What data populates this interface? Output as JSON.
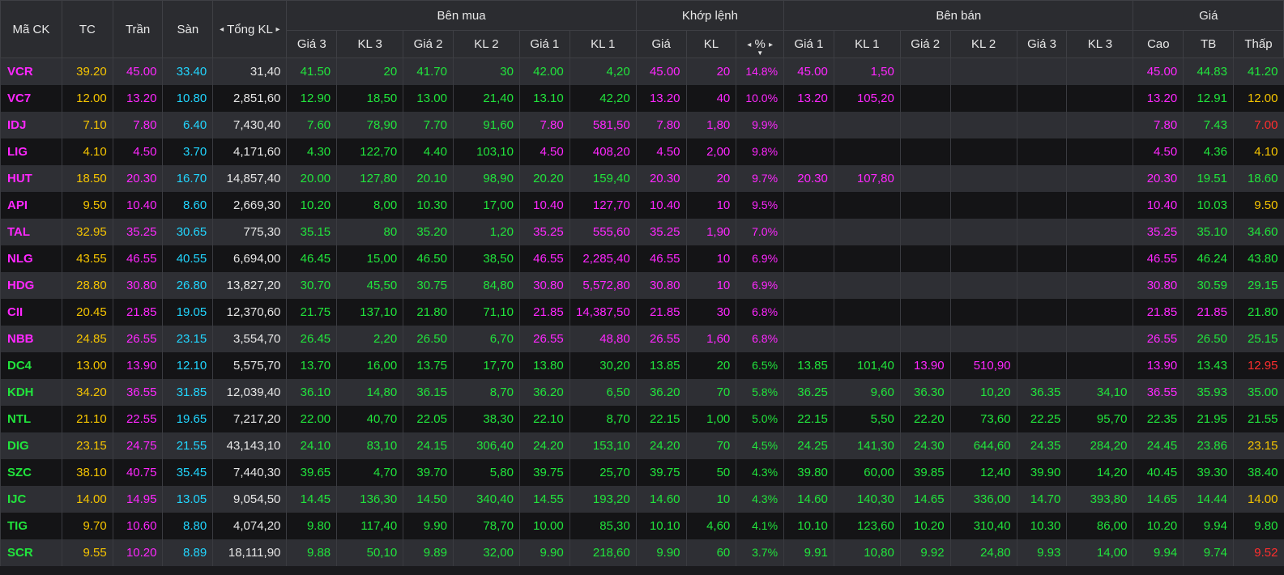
{
  "headers": {
    "symbol": "Mã CK",
    "ref": "TC",
    "ceil": "Trần",
    "floor": "Sàn",
    "total": "Tổng KL",
    "buy_group": "Bên mua",
    "match_group": "Khớp lệnh",
    "sell_group": "Bên bán",
    "price_group": "Giá",
    "buy_cols": [
      "Giá 3",
      "KL 3",
      "Giá 2",
      "KL 2",
      "Giá 1",
      "KL 1"
    ],
    "match_cols": [
      "Giá",
      "KL",
      "%"
    ],
    "sell_cols": [
      "Giá 1",
      "KL 1",
      "Giá 2",
      "KL 2",
      "Giá 3",
      "KL 3"
    ],
    "price_cols": [
      "Cao",
      "TB",
      "Thấp"
    ]
  },
  "icons": {
    "left": "◂",
    "right": "▸",
    "sort_down": "▼"
  },
  "colors": {
    "ref": "#f5c400",
    "ceil": "#ff27ff",
    "floor": "#21d6ff",
    "up": "#21e43c",
    "down": "#ff2e2e"
  },
  "rows": [
    {
      "sym": "VCR",
      "tc": "39.20",
      "tran": "45.00",
      "san": "33.40",
      "tong": "31,40",
      "b3": "41.50",
      "bv3": "20",
      "b2": "41.70",
      "bv2": "30",
      "b1": "42.00",
      "bv1": "4,20",
      "mp": "45.00",
      "mv": "20",
      "pct": "14.8%",
      "s1": "45.00",
      "sv1": "1,50",
      "s2": "",
      "sv2": "",
      "s3": "",
      "sv3": "",
      "cao": "45.00",
      "tb": "44.83",
      "thap": "41.20"
    },
    {
      "sym": "VC7",
      "tc": "12.00",
      "tran": "13.20",
      "san": "10.80",
      "tong": "2,851,60",
      "b3": "12.90",
      "bv3": "18,50",
      "b2": "13.00",
      "bv2": "21,40",
      "b1": "13.10",
      "bv1": "42,20",
      "mp": "13.20",
      "mv": "40",
      "pct": "10.0%",
      "s1": "13.20",
      "sv1": "105,20",
      "s2": "",
      "sv2": "",
      "s3": "",
      "sv3": "",
      "cao": "13.20",
      "tb": "12.91",
      "thap": "12.00"
    },
    {
      "sym": "IDJ",
      "tc": "7.10",
      "tran": "7.80",
      "san": "6.40",
      "tong": "7,430,40",
      "b3": "7.60",
      "bv3": "78,90",
      "b2": "7.70",
      "bv2": "91,60",
      "b1": "7.80",
      "bv1": "581,50",
      "mp": "7.80",
      "mv": "1,80",
      "pct": "9.9%",
      "s1": "",
      "sv1": "",
      "s2": "",
      "sv2": "",
      "s3": "",
      "sv3": "",
      "cao": "7.80",
      "tb": "7.43",
      "thap": "7.00"
    },
    {
      "sym": "LIG",
      "tc": "4.10",
      "tran": "4.50",
      "san": "3.70",
      "tong": "4,171,60",
      "b3": "4.30",
      "bv3": "122,70",
      "b2": "4.40",
      "bv2": "103,10",
      "b1": "4.50",
      "bv1": "408,20",
      "mp": "4.50",
      "mv": "2,00",
      "pct": "9.8%",
      "s1": "",
      "sv1": "",
      "s2": "",
      "sv2": "",
      "s3": "",
      "sv3": "",
      "cao": "4.50",
      "tb": "4.36",
      "thap": "4.10"
    },
    {
      "sym": "HUT",
      "tc": "18.50",
      "tran": "20.30",
      "san": "16.70",
      "tong": "14,857,40",
      "b3": "20.00",
      "bv3": "127,80",
      "b2": "20.10",
      "bv2": "98,90",
      "b1": "20.20",
      "bv1": "159,40",
      "mp": "20.30",
      "mv": "20",
      "pct": "9.7%",
      "s1": "20.30",
      "sv1": "107,80",
      "s2": "",
      "sv2": "",
      "s3": "",
      "sv3": "",
      "cao": "20.30",
      "tb": "19.51",
      "thap": "18.60"
    },
    {
      "sym": "API",
      "tc": "9.50",
      "tran": "10.40",
      "san": "8.60",
      "tong": "2,669,30",
      "b3": "10.20",
      "bv3": "8,00",
      "b2": "10.30",
      "bv2": "17,00",
      "b1": "10.40",
      "bv1": "127,70",
      "mp": "10.40",
      "mv": "10",
      "pct": "9.5%",
      "s1": "",
      "sv1": "",
      "s2": "",
      "sv2": "",
      "s3": "",
      "sv3": "",
      "cao": "10.40",
      "tb": "10.03",
      "thap": "9.50"
    },
    {
      "sym": "TAL",
      "tc": "32.95",
      "tran": "35.25",
      "san": "30.65",
      "tong": "775,30",
      "b3": "35.15",
      "bv3": "80",
      "b2": "35.20",
      "bv2": "1,20",
      "b1": "35.25",
      "bv1": "555,60",
      "mp": "35.25",
      "mv": "1,90",
      "pct": "7.0%",
      "s1": "",
      "sv1": "",
      "s2": "",
      "sv2": "",
      "s3": "",
      "sv3": "",
      "cao": "35.25",
      "tb": "35.10",
      "thap": "34.60"
    },
    {
      "sym": "NLG",
      "tc": "43.55",
      "tran": "46.55",
      "san": "40.55",
      "tong": "6,694,00",
      "b3": "46.45",
      "bv3": "15,00",
      "b2": "46.50",
      "bv2": "38,50",
      "b1": "46.55",
      "bv1": "2,285,40",
      "mp": "46.55",
      "mv": "10",
      "pct": "6.9%",
      "s1": "",
      "sv1": "",
      "s2": "",
      "sv2": "",
      "s3": "",
      "sv3": "",
      "cao": "46.55",
      "tb": "46.24",
      "thap": "43.80"
    },
    {
      "sym": "HDG",
      "tc": "28.80",
      "tran": "30.80",
      "san": "26.80",
      "tong": "13,827,20",
      "b3": "30.70",
      "bv3": "45,50",
      "b2": "30.75",
      "bv2": "84,80",
      "b1": "30.80",
      "bv1": "5,572,80",
      "mp": "30.80",
      "mv": "10",
      "pct": "6.9%",
      "s1": "",
      "sv1": "",
      "s2": "",
      "sv2": "",
      "s3": "",
      "sv3": "",
      "cao": "30.80",
      "tb": "30.59",
      "thap": "29.15"
    },
    {
      "sym": "CII",
      "tc": "20.45",
      "tran": "21.85",
      "san": "19.05",
      "tong": "12,370,60",
      "b3": "21.75",
      "bv3": "137,10",
      "b2": "21.80",
      "bv2": "71,10",
      "b1": "21.85",
      "bv1": "14,387,50",
      "mp": "21.85",
      "mv": "30",
      "pct": "6.8%",
      "s1": "",
      "sv1": "",
      "s2": "",
      "sv2": "",
      "s3": "",
      "sv3": "",
      "cao": "21.85",
      "tb": "21.85",
      "thap": "21.80"
    },
    {
      "sym": "NBB",
      "tc": "24.85",
      "tran": "26.55",
      "san": "23.15",
      "tong": "3,554,70",
      "b3": "26.45",
      "bv3": "2,20",
      "b2": "26.50",
      "bv2": "6,70",
      "b1": "26.55",
      "bv1": "48,80",
      "mp": "26.55",
      "mv": "1,60",
      "pct": "6.8%",
      "s1": "",
      "sv1": "",
      "s2": "",
      "sv2": "",
      "s3": "",
      "sv3": "",
      "cao": "26.55",
      "tb": "26.50",
      "thap": "25.15"
    },
    {
      "sym": "DC4",
      "tc": "13.00",
      "tran": "13.90",
      "san": "12.10",
      "tong": "5,575,70",
      "b3": "13.70",
      "bv3": "16,00",
      "b2": "13.75",
      "bv2": "17,70",
      "b1": "13.80",
      "bv1": "30,20",
      "mp": "13.85",
      "mv": "20",
      "pct": "6.5%",
      "s1": "13.85",
      "sv1": "101,40",
      "s2": "13.90",
      "sv2": "510,90",
      "s3": "",
      "sv3": "",
      "cao": "13.90",
      "tb": "13.43",
      "thap": "12.95"
    },
    {
      "sym": "KDH",
      "tc": "34.20",
      "tran": "36.55",
      "san": "31.85",
      "tong": "12,039,40",
      "b3": "36.10",
      "bv3": "14,80",
      "b2": "36.15",
      "bv2": "8,70",
      "b1": "36.20",
      "bv1": "6,50",
      "mp": "36.20",
      "mv": "70",
      "pct": "5.8%",
      "s1": "36.25",
      "sv1": "9,60",
      "s2": "36.30",
      "sv2": "10,20",
      "s3": "36.35",
      "sv3": "34,10",
      "cao": "36.55",
      "tb": "35.93",
      "thap": "35.00"
    },
    {
      "sym": "NTL",
      "tc": "21.10",
      "tran": "22.55",
      "san": "19.65",
      "tong": "7,217,20",
      "b3": "22.00",
      "bv3": "40,70",
      "b2": "22.05",
      "bv2": "38,30",
      "b1": "22.10",
      "bv1": "8,70",
      "mp": "22.15",
      "mv": "1,00",
      "pct": "5.0%",
      "s1": "22.15",
      "sv1": "5,50",
      "s2": "22.20",
      "sv2": "73,60",
      "s3": "22.25",
      "sv3": "95,70",
      "cao": "22.35",
      "tb": "21.95",
      "thap": "21.55"
    },
    {
      "sym": "DIG",
      "tc": "23.15",
      "tran": "24.75",
      "san": "21.55",
      "tong": "43,143,10",
      "b3": "24.10",
      "bv3": "83,10",
      "b2": "24.15",
      "bv2": "306,40",
      "b1": "24.20",
      "bv1": "153,10",
      "mp": "24.20",
      "mv": "70",
      "pct": "4.5%",
      "s1": "24.25",
      "sv1": "141,30",
      "s2": "24.30",
      "sv2": "644,60",
      "s3": "24.35",
      "sv3": "284,20",
      "cao": "24.45",
      "tb": "23.86",
      "thap": "23.15"
    },
    {
      "sym": "SZC",
      "tc": "38.10",
      "tran": "40.75",
      "san": "35.45",
      "tong": "7,440,30",
      "b3": "39.65",
      "bv3": "4,70",
      "b2": "39.70",
      "bv2": "5,80",
      "b1": "39.75",
      "bv1": "25,70",
      "mp": "39.75",
      "mv": "50",
      "pct": "4.3%",
      "s1": "39.80",
      "sv1": "60,00",
      "s2": "39.85",
      "sv2": "12,40",
      "s3": "39.90",
      "sv3": "14,20",
      "cao": "40.45",
      "tb": "39.30",
      "thap": "38.40"
    },
    {
      "sym": "IJC",
      "tc": "14.00",
      "tran": "14.95",
      "san": "13.05",
      "tong": "9,054,50",
      "b3": "14.45",
      "bv3": "136,30",
      "b2": "14.50",
      "bv2": "340,40",
      "b1": "14.55",
      "bv1": "193,20",
      "mp": "14.60",
      "mv": "10",
      "pct": "4.3%",
      "s1": "14.60",
      "sv1": "140,30",
      "s2": "14.65",
      "sv2": "336,00",
      "s3": "14.70",
      "sv3": "393,80",
      "cao": "14.65",
      "tb": "14.44",
      "thap": "14.00"
    },
    {
      "sym": "TIG",
      "tc": "9.70",
      "tran": "10.60",
      "san": "8.80",
      "tong": "4,074,20",
      "b3": "9.80",
      "bv3": "117,40",
      "b2": "9.90",
      "bv2": "78,70",
      "b1": "10.00",
      "bv1": "85,30",
      "mp": "10.10",
      "mv": "4,60",
      "pct": "4.1%",
      "s1": "10.10",
      "sv1": "123,60",
      "s2": "10.20",
      "sv2": "310,40",
      "s3": "10.30",
      "sv3": "86,00",
      "cao": "10.20",
      "tb": "9.94",
      "thap": "9.80"
    },
    {
      "sym": "SCR",
      "tc": "9.55",
      "tran": "10.20",
      "san": "8.89",
      "tong": "18,111,90",
      "b3": "9.88",
      "bv3": "50,10",
      "b2": "9.89",
      "bv2": "32,00",
      "b1": "9.90",
      "bv1": "218,60",
      "mp": "9.90",
      "mv": "60",
      "pct": "3.7%",
      "s1": "9.91",
      "sv1": "10,80",
      "s2": "9.92",
      "sv2": "24,80",
      "s3": "9.93",
      "sv3": "14,00",
      "cao": "9.94",
      "tb": "9.74",
      "thap": "9.52"
    }
  ]
}
